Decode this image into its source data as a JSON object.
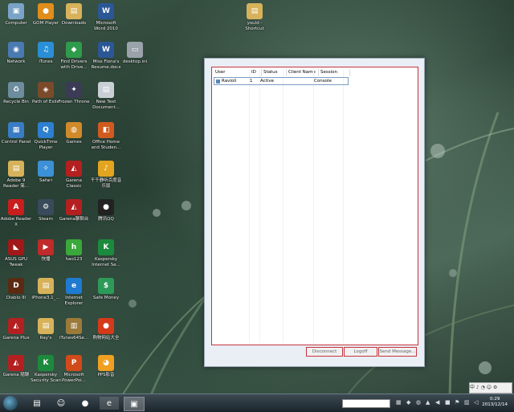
{
  "desktop_icons": [
    {
      "label": "Computer",
      "icon": "computer-icon",
      "color": "#7aa3c7",
      "glyph": "▣"
    },
    {
      "label": "GOM Player",
      "icon": "gom-player-icon",
      "color": "#e08d1c",
      "glyph": "●"
    },
    {
      "label": "Downloads",
      "icon": "folder-icon",
      "color": "#d7b25a",
      "glyph": "▤"
    },
    {
      "label": "Microsoft Word 2010",
      "icon": "word-icon",
      "color": "#2b5797",
      "glyph": "W"
    },
    {
      "label": "Network",
      "icon": "network-icon",
      "color": "#4a7ab2",
      "glyph": "◉"
    },
    {
      "label": "iTunes",
      "icon": "itunes-icon",
      "color": "#2a8fd6",
      "glyph": "♫"
    },
    {
      "label": "Find Drivers with Drive...",
      "icon": "driver-icon",
      "color": "#2f9c4b",
      "glyph": "◆"
    },
    {
      "label": "Miss Fiona's Resume.docx",
      "icon": "docx-icon",
      "color": "#2b5797",
      "glyph": "W"
    },
    {
      "label": "desktop.ini",
      "icon": "ini-file-icon",
      "color": "#9aa3aa",
      "glyph": "▭"
    },
    {
      "label": "Recycle Bin",
      "icon": "recycle-bin-icon",
      "color": "#6d8d9e",
      "glyph": "♻"
    },
    {
      "label": "Path of Exile",
      "icon": "path-of-exile-icon",
      "color": "#7b4a2b",
      "glyph": "◈"
    },
    {
      "label": "Frozen Throne",
      "icon": "frozen-throne-icon",
      "color": "#3b3b55",
      "glyph": "✦"
    },
    {
      "label": "New Text Document...",
      "icon": "text-document-icon",
      "color": "#c9cfd4",
      "glyph": "▤"
    },
    {
      "label": "Control Panel",
      "icon": "control-panel-icon",
      "color": "#3a7cc4",
      "glyph": "▦"
    },
    {
      "label": "QuickTime Player",
      "icon": "quicktime-icon",
      "color": "#2d7fd0",
      "glyph": "Q"
    },
    {
      "label": "Games",
      "icon": "games-icon",
      "color": "#d08a2a",
      "glyph": "◍"
    },
    {
      "label": "Office Home and Studen...",
      "icon": "office-icon",
      "color": "#d15b1f",
      "glyph": "◧"
    },
    {
      "label": "Adobe 9 Reader 简...",
      "icon": "folder-icon",
      "color": "#d7b25a",
      "glyph": "▤"
    },
    {
      "label": "Safari",
      "icon": "safari-icon",
      "color": "#3c90d6",
      "glyph": "✧"
    },
    {
      "label": "Garena Classic",
      "icon": "garena-icon",
      "color": "#b42020",
      "glyph": "◭"
    },
    {
      "label": "千千静听百度音乐版",
      "icon": "music-icon",
      "color": "#e3a51f",
      "glyph": "♪"
    },
    {
      "label": "Adobe Reader X",
      "icon": "adobe-reader-icon",
      "color": "#c81e1e",
      "glyph": "A"
    },
    {
      "label": "Steam",
      "icon": "steam-icon",
      "color": "#394a5a",
      "glyph": "⚙"
    },
    {
      "label": "Garena聊聊台",
      "icon": "garena-icon",
      "color": "#b42020",
      "glyph": "◭"
    },
    {
      "label": "腾讯QQ",
      "icon": "qq-icon",
      "color": "#222222",
      "glyph": "●"
    },
    {
      "label": "ASUS GPU Tweak",
      "icon": "asus-icon",
      "color": "#a01818",
      "glyph": "◣"
    },
    {
      "label": "快播",
      "icon": "qvod-icon",
      "color": "#c02a2a",
      "glyph": "▶"
    },
    {
      "label": "hao123",
      "icon": "hao123-icon",
      "color": "#3aa83a",
      "glyph": "h"
    },
    {
      "label": "Kaspersky Internet Se...",
      "icon": "kaspersky-icon",
      "color": "#1c8a3c",
      "glyph": "K"
    },
    {
      "label": "Diablo III",
      "icon": "diablo-icon",
      "color": "#5b2a12",
      "glyph": "D"
    },
    {
      "label": "iPhone3,1_...",
      "icon": "folder-icon",
      "color": "#d7b25a",
      "glyph": "▤"
    },
    {
      "label": "Internet Explorer",
      "icon": "ie-icon",
      "color": "#1f7ad1",
      "glyph": "e"
    },
    {
      "label": "Safe Money",
      "icon": "safe-money-icon",
      "color": "#2e9a5a",
      "glyph": "$"
    },
    {
      "label": "Garena Plus",
      "icon": "garena-icon",
      "color": "#b42020",
      "glyph": "◭"
    },
    {
      "label": "Ray's",
      "icon": "folder-icon",
      "color": "#d7b25a",
      "glyph": "▤"
    },
    {
      "label": "iTunes64Se...",
      "icon": "installer-icon",
      "color": "#9c7a3a",
      "glyph": "▥"
    },
    {
      "label": "购物网站大全",
      "icon": "shopping-icon",
      "color": "#d43a1a",
      "glyph": "●"
    },
    {
      "label": "Garena 隨聊",
      "icon": "garena-icon",
      "color": "#b42020",
      "glyph": "◭"
    },
    {
      "label": "Kaspersky Security Scan",
      "icon": "kaspersky-icon",
      "color": "#1c8a3c",
      "glyph": "K"
    },
    {
      "label": "Microsoft PowerPoi...",
      "icon": "powerpoint-icon",
      "color": "#d04a1a",
      "glyph": "P"
    },
    {
      "label": "PPS影音",
      "icon": "pps-icon",
      "color": "#f0a020",
      "glyph": "◕"
    },
    {
      "label": "yould - Shortcut",
      "icon": "folder-icon",
      "color": "#d7b25a",
      "glyph": "▤"
    }
  ],
  "window": {
    "columns": [
      "User",
      "ID",
      "Status",
      "Client Name",
      "Session"
    ],
    "rows": [
      {
        "user": "Ravioli",
        "id": "1",
        "status": "Active",
        "client": "",
        "session": "Console"
      }
    ],
    "buttons": {
      "disconnect": "Disconnect",
      "logoff": "Logoff",
      "send_message": "Send Message..."
    }
  },
  "taskbar": {
    "clock_time": "0:29",
    "clock_date": "2013/12/14",
    "lang_bar": "中 ♪ ◔ ☺ ⚙"
  }
}
